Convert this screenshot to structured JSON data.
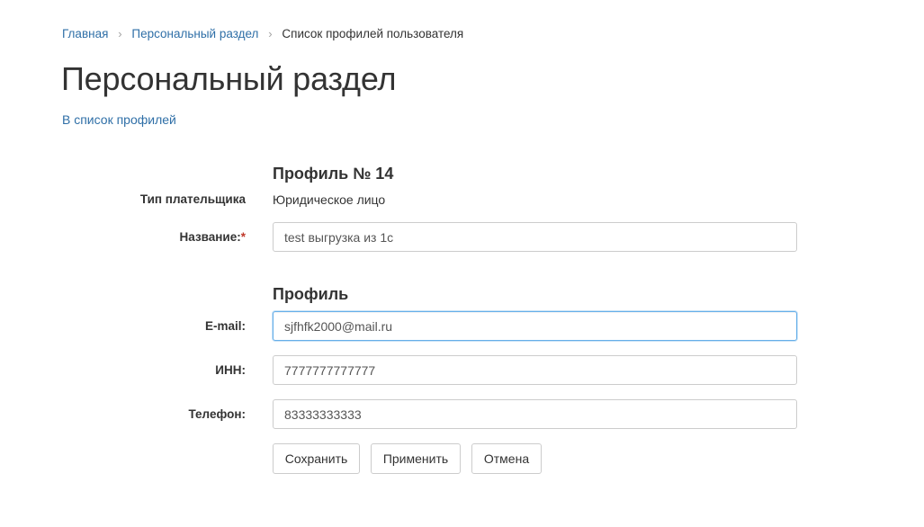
{
  "breadcrumb": {
    "items": [
      "Главная",
      "Персональный раздел"
    ],
    "current": "Список профилей пользователя",
    "separator": "›"
  },
  "page_title": "Персональный раздел",
  "back_link": "В список профилей",
  "profile_section": {
    "title": "Профиль № 14",
    "payer_type_label": "Тип плательщика",
    "payer_type_value": "Юридическое лицо",
    "name_label": "Название:",
    "name_required_mark": "*",
    "name_value": "test выгрузка из 1с"
  },
  "contact_section": {
    "title": "Профиль",
    "email_label": "E-mail:",
    "email_value": "sjfhfk2000@mail.ru",
    "inn_label": "ИНН:",
    "inn_value": "7777777777777",
    "phone_label": "Телефон:",
    "phone_value": "83333333333"
  },
  "buttons": {
    "save": "Сохранить",
    "apply": "Применить",
    "cancel": "Отмена"
  },
  "colors": {
    "link": "#2f6fa7",
    "text": "#333333",
    "required": "#c0392b",
    "focus_border": "#66afe9"
  }
}
